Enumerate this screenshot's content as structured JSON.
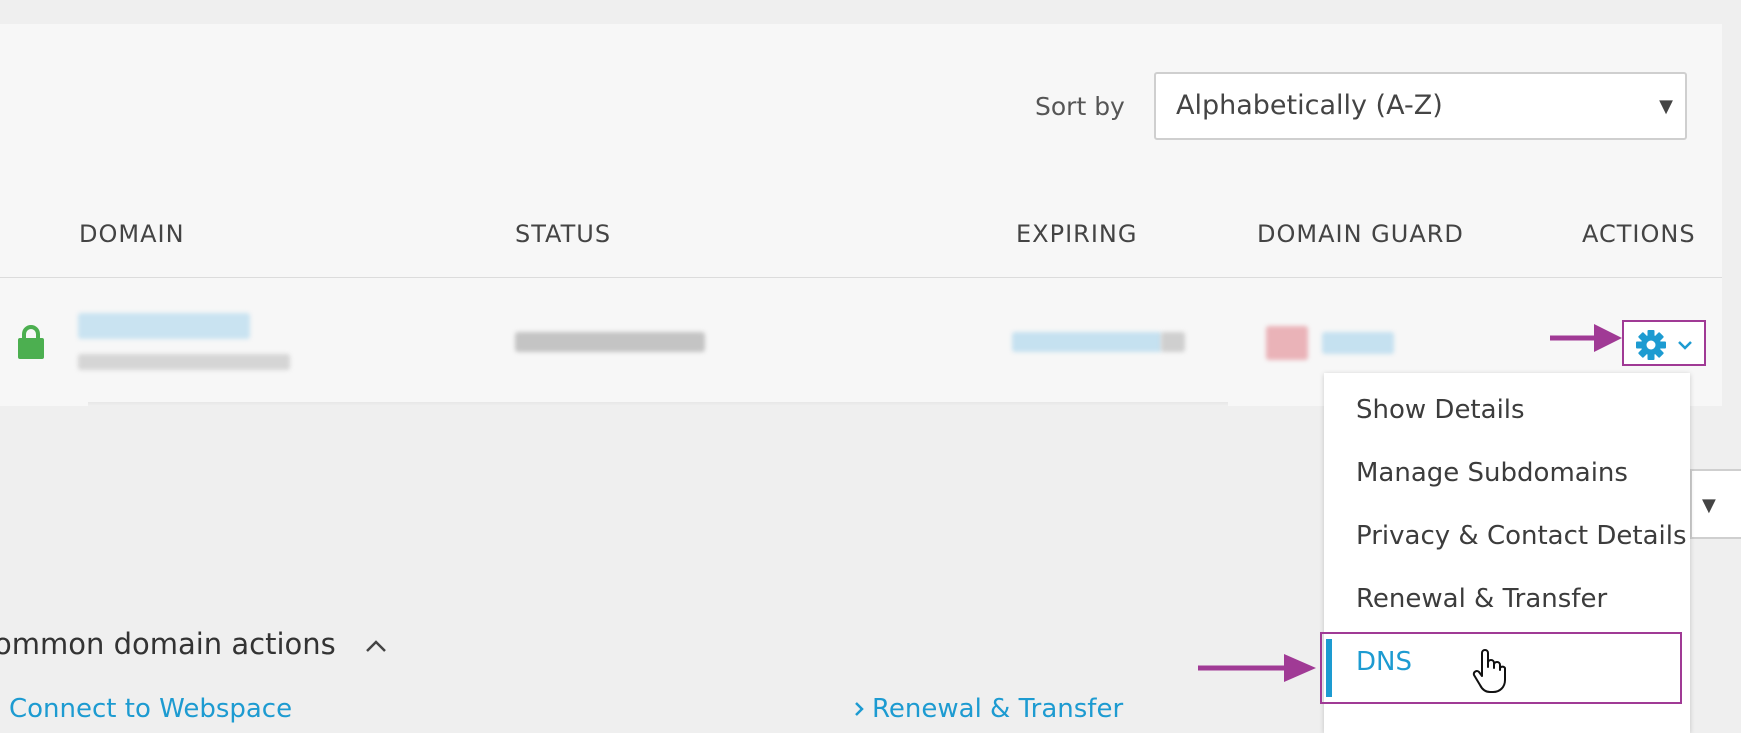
{
  "sort": {
    "label": "Sort by",
    "value": "Alphabetically (A-Z)"
  },
  "table": {
    "headers": {
      "domain": "DOMAIN",
      "status": "STATUS",
      "expiring": "EXPIRING",
      "domain_guard": "DOMAIN GUARD",
      "actions": "ACTIONS"
    }
  },
  "actions_menu": {
    "items": [
      {
        "label": "Show Details"
      },
      {
        "label": "Manage Subdomains"
      },
      {
        "label": "Privacy & Contact Details"
      },
      {
        "label": "Renewal & Transfer"
      },
      {
        "label": "DNS"
      }
    ],
    "active_item": "DNS"
  },
  "common_actions": {
    "title": "ommon domain actions",
    "links": [
      {
        "label": "Connect to Webspace"
      },
      {
        "label": "Renewal & Transfer"
      }
    ]
  },
  "colors": {
    "accent": "#1d9bd1",
    "annotation": "#a03a95",
    "lock": "#4caf50"
  },
  "icons": {
    "lock": "lock-icon",
    "gear": "gear-icon",
    "chevron": "chevron-down-icon",
    "collapse": "chevron-up-icon",
    "link_chevron": "chevron-right-icon",
    "cursor": "hand-pointer-icon"
  }
}
